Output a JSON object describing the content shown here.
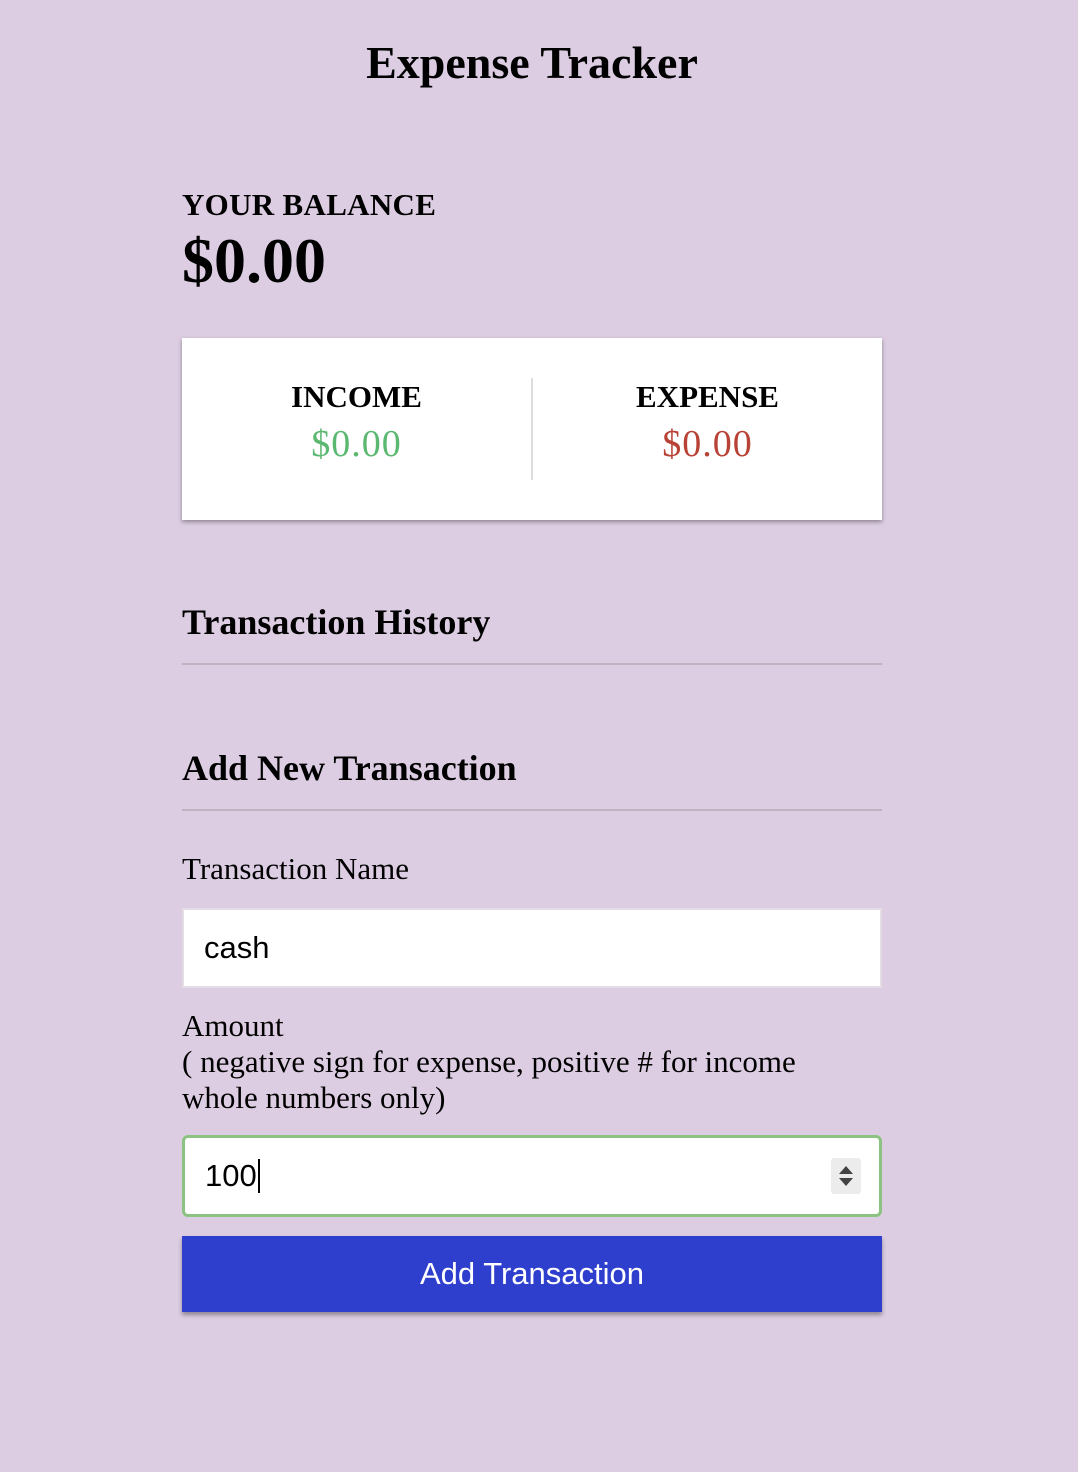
{
  "header": {
    "title": "Expense Tracker"
  },
  "balance": {
    "label": "YOUR BALANCE",
    "amount": "$0.00"
  },
  "summary": {
    "income_label": "INCOME",
    "income_value": "$0.00",
    "expense_label": "EXPENSE",
    "expense_value": "$0.00",
    "income_color": "#5bb870",
    "expense_color": "#b94236"
  },
  "history": {
    "title": "Transaction History"
  },
  "form": {
    "title": "Add New Transaction",
    "name_label": "Transaction Name",
    "name_value": "cash",
    "amount_label": "Amount",
    "amount_hint_line1": "( negative sign for expense, positive # for income",
    "amount_hint_line2": "whole numbers only)",
    "amount_value": "100",
    "submit_label": "Add Transaction",
    "submit_color": "#2e3fce",
    "focus_color": "#8cc382"
  },
  "colors": {
    "background": "#dccde2"
  }
}
